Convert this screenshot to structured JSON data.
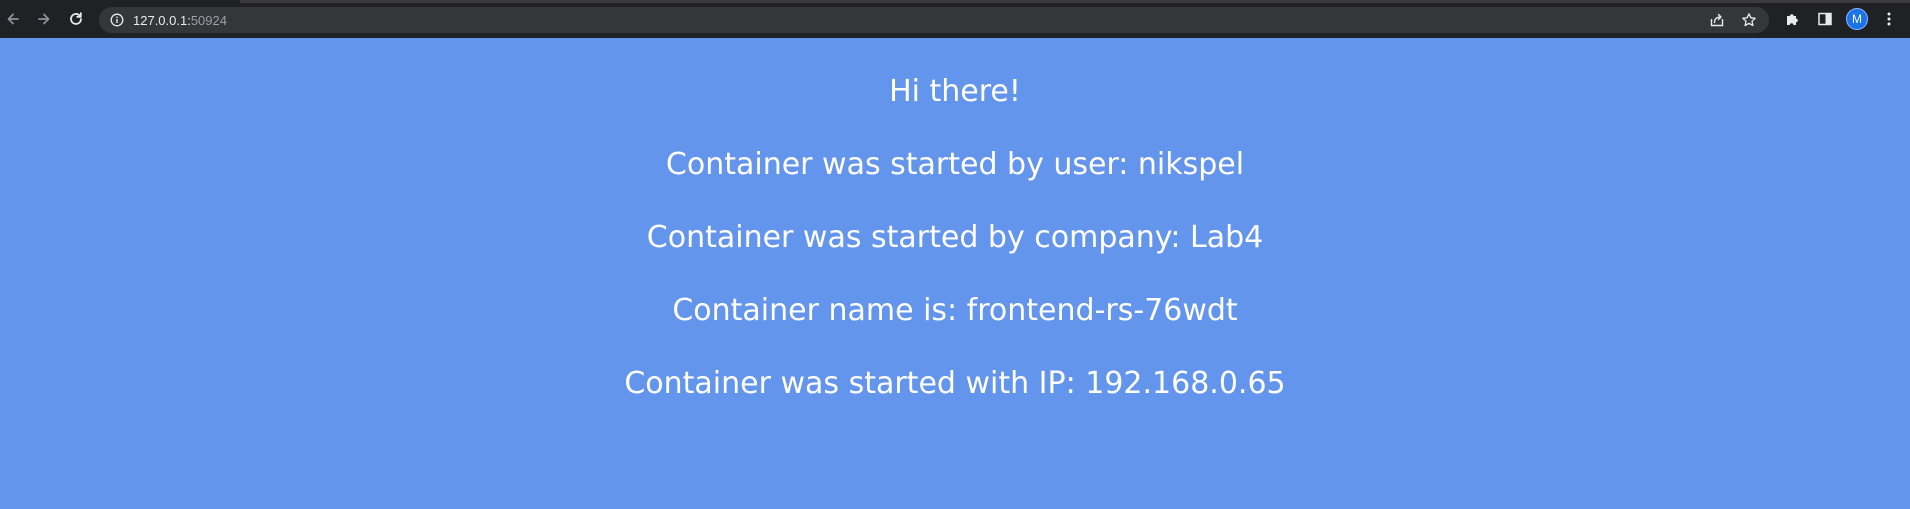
{
  "browser": {
    "url_host": "127.0.0.1:",
    "url_port": "50924",
    "profile_initial": "M",
    "icons": {
      "back": "arrow-left-icon",
      "forward": "arrow-right-icon",
      "reload": "reload-icon",
      "site_info": "info-icon",
      "share": "share-icon",
      "bookmark": "star-icon",
      "extensions": "puzzle-icon",
      "side_panel": "side-panel-icon",
      "menu": "kebab-menu-icon"
    },
    "colors": {
      "toolbar": "#202124",
      "omnibox": "#35363a",
      "avatar": "#1a73e8"
    }
  },
  "page": {
    "background": "#6495ED",
    "text_color": "#ffffff",
    "greeting": "Hi there!",
    "user_line": "Container was started by user: nikspel",
    "company_line": "Container was started by company: Lab4",
    "name_line": "Container name is: frontend-rs-76wdt",
    "ip_line": "Container was started with IP: 192.168.0.65"
  }
}
